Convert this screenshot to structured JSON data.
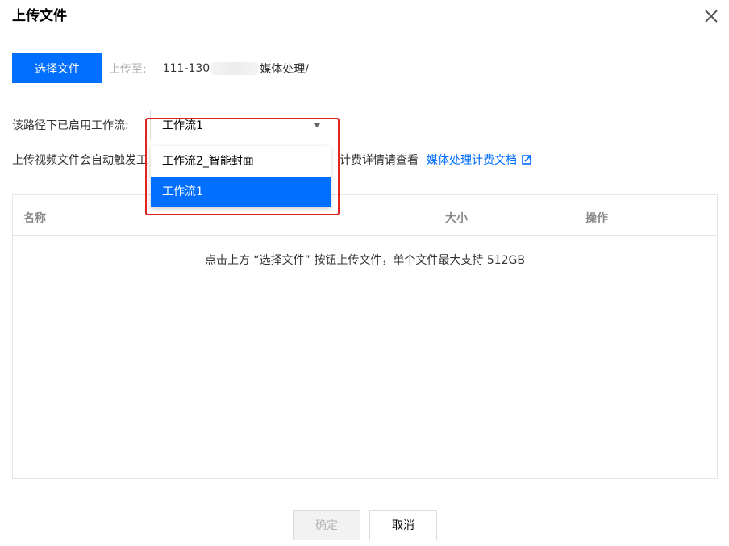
{
  "dialog": {
    "title": "上传文件",
    "close_icon": "close-icon"
  },
  "upload": {
    "select_button": "选择文件",
    "upload_to_label": "上传至:",
    "path_prefix": "111-130",
    "path_suffix": "媒体处理/"
  },
  "workflow": {
    "label": "该路径下已启用工作流:",
    "selected_value": "工作流1",
    "options": [
      {
        "label": "工作流2_智能封面",
        "selected": false
      },
      {
        "label": "工作流1",
        "selected": true
      }
    ]
  },
  "notice": {
    "text_before": "上传视频文件会自动触发工",
    "text_after": "计费详情请查看",
    "link_text": "媒体处理计费文档",
    "link_icon": "external-link-icon"
  },
  "table": {
    "columns": [
      "名称",
      "大小",
      "操作"
    ],
    "empty_text": "点击上方 “选择文件” 按钮上传文件，单个文件最大支持 512GB"
  },
  "footer": {
    "ok_label": "确定",
    "cancel_label": "取消"
  },
  "colors": {
    "primary": "#006eff",
    "highlight": "#e0241f"
  }
}
